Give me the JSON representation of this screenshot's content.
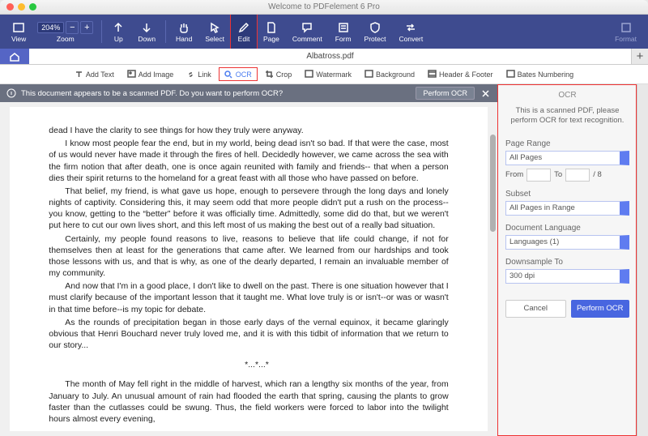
{
  "title": "Welcome to PDFelement 6 Pro",
  "right_label": "Format",
  "toolbar": {
    "view": "View",
    "zoom": "Zoom",
    "zoom_value": "204%",
    "up": "Up",
    "down": "Down",
    "hand": "Hand",
    "select": "Select",
    "edit": "Edit",
    "page": "Page",
    "comment": "Comment",
    "form": "Form",
    "protect": "Protect",
    "convert": "Convert"
  },
  "tab": "Albatross.pdf",
  "subtool": {
    "add_text": "Add Text",
    "add_image": "Add Image",
    "link": "Link",
    "ocr": "OCR",
    "crop": "Crop",
    "watermark": "Watermark",
    "background": "Background",
    "header_footer": "Header & Footer",
    "bates": "Bates Numbering"
  },
  "notice": {
    "msg": "This document appears to be a scanned PDF. Do you want to perform OCR?",
    "btn": "Perform OCR"
  },
  "panel": {
    "title": "OCR",
    "info": "This is a scanned PDF, please perform OCR for text recognition.",
    "page_range_l": "Page Range",
    "page_range_v": "All Pages",
    "from_l": "From",
    "to_l": "To",
    "total": "/ 8",
    "subset_l": "Subset",
    "subset_v": "All Pages in Range",
    "lang_l": "Document Language",
    "lang_v": "Languages (1)",
    "down_l": "Downsample To",
    "down_v": "300 dpi",
    "cancel": "Cancel",
    "perform": "Perform OCR"
  },
  "doc": {
    "p1": "dead I have the clarity to see things for how they truly were anyway.",
    "p2": "I know most people fear the end, but in my world, being dead isn't so bad. If that were the case, most of us would never have made it through the fires of hell. Decidedly however, we came across the sea with the firm notion that after death, one is once again reunited with family and friends-- that when a person dies their spirit returns to the homeland for a great feast with all those who have passed on before.",
    "p3": "That belief, my friend, is what gave us hope, enough to persevere through the long days and lonely nights of captivity. Considering this, it may seem odd that more people didn't put a rush on the process--you know, getting to the “better” before it was officially time. Admittedly, some did do that, but we weren't put here to cut our own lives short, and this left most of us making the best out of a really bad situation.",
    "p4": "Certainly, my people found reasons to live, reasons to believe that life could change, if not for themselves then at least for the generations that came after. We learned from our hardships and took those lessons with us, and that is why, as one of the dearly departed, I remain an invaluable member of my community.",
    "p5": "And now that I'm in a good place, I don't like to dwell on the past. There is one situation however that I must clarify because of the important lesson that it taught me. What love truly is or isn't--or was or wasn't in that time before--is my topic for debate.",
    "p6": "As the rounds of precipitation began in those early days of the vernal equinox, it became glaringly obvious that Henri Bouchard never truly loved me, and it is with this tidbit of information that we return to our story...",
    "sep": "*...*...*",
    "p7": "The month of May fell right in the middle of harvest, which ran a lengthy six months of the year, from January to July. An unusual amount of rain had flooded the earth that spring, causing the plants to grow faster than the cutlasses could be swung. Thus, the field workers were forced to labor into the twilight hours almost every evening,"
  }
}
